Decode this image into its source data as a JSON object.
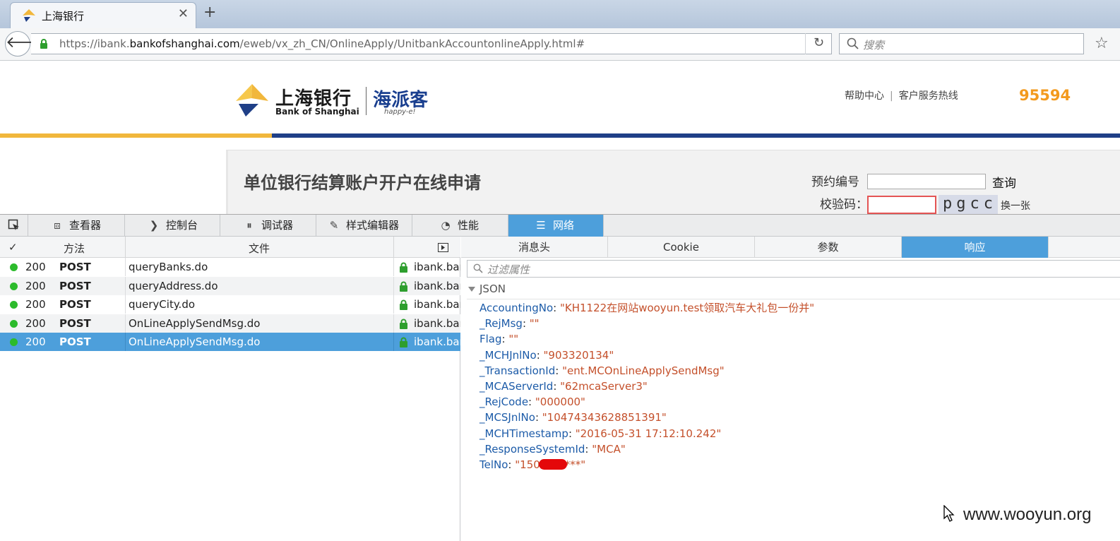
{
  "browser": {
    "tab_title": "上海银行",
    "new_tab_label": "+",
    "url_prefix": "https://ibank.",
    "url_domain": "bankofshanghai.com",
    "url_path": "/eweb/vx_zh_CN/OnlineApply/UnitbankAccountonlineApply.html#",
    "search_placeholder": "搜索"
  },
  "site": {
    "logo_cn": "上海银行",
    "logo_en": "Bank of Shanghai",
    "brand_cn": "海派客",
    "brand_en": "happy-e!",
    "help_link": "帮助中心",
    "service_link": "客户服务热线",
    "hotline": "95594",
    "page_title": "单位银行结算账户开户在线申请",
    "reservation_label": "预约编号",
    "query_button": "查询",
    "verify_label": "校验码：",
    "captcha_text": "pgcc",
    "captcha_refresh": "换一张"
  },
  "devtools": {
    "tabs": [
      {
        "label": "查看器",
        "icon": "inspector-icon"
      },
      {
        "label": "控制台",
        "icon": "console-icon"
      },
      {
        "label": "调试器",
        "icon": "debugger-icon"
      },
      {
        "label": "样式编辑器",
        "icon": "style-editor-icon"
      },
      {
        "label": "性能",
        "icon": "performance-icon"
      },
      {
        "label": "网络",
        "icon": "network-icon"
      }
    ],
    "active_tab": "网络",
    "columns": {
      "status": "✓",
      "method": "方法",
      "file": "文件"
    },
    "requests": [
      {
        "status": "200",
        "method": "POST",
        "file": "queryBanks.do",
        "domain": "ibank.bankofshanghai.com"
      },
      {
        "status": "200",
        "method": "POST",
        "file": "queryAddress.do",
        "domain": "ibank.bankofshanghai.com"
      },
      {
        "status": "200",
        "method": "POST",
        "file": "queryCity.do",
        "domain": "ibank.bankofshanghai.com"
      },
      {
        "status": "200",
        "method": "POST",
        "file": "OnLineApplySendMsg.do",
        "domain": "ibank.bankofshanghai.com"
      },
      {
        "status": "200",
        "method": "POST",
        "file": "OnLineApplySendMsg.do",
        "domain": "ibank.bankofshanghai.com"
      }
    ],
    "selected_request_index": 4,
    "detail_tabs": [
      "消息头",
      "Cookie",
      "参数",
      "响应"
    ],
    "active_detail_tab": "响应",
    "filter_placeholder": "过滤属性",
    "json_label": "JSON",
    "json": [
      {
        "key": "AccountingNo",
        "value": "\"KH1122在网站wooyun.test领取汽车大礼包一份并\""
      },
      {
        "key": "_RejMsg",
        "value": "\"\""
      },
      {
        "key": "Flag",
        "value": "\"\""
      },
      {
        "key": "_MCHJnlNo",
        "value": "\"903320134\""
      },
      {
        "key": "_TransactionId",
        "value": "\"ent.MCOnLineApplySendMsg\""
      },
      {
        "key": "_MCAServerId",
        "value": "\"62mcaServer3\""
      },
      {
        "key": "_RejCode",
        "value": "\"000000\""
      },
      {
        "key": "_MCSJnlNo",
        "value": "\"10474343628851391\""
      },
      {
        "key": "_MCHTimestamp",
        "value": "\"2016-05-31 17:12:10.242\""
      },
      {
        "key": "_ResponseSystemId",
        "value": "\"MCA\""
      },
      {
        "key": "TelNo",
        "value_prefix": "\"150",
        "value_suffix": "*****\""
      }
    ]
  },
  "watermark": "www.wooyun.org",
  "colors": {
    "accent": "#4d9fdb",
    "status_ok": "#2cbb2c",
    "hotline": "#f39a1e",
    "brand_blue": "#1f3f87",
    "brand_gold": "#f1b73c"
  }
}
